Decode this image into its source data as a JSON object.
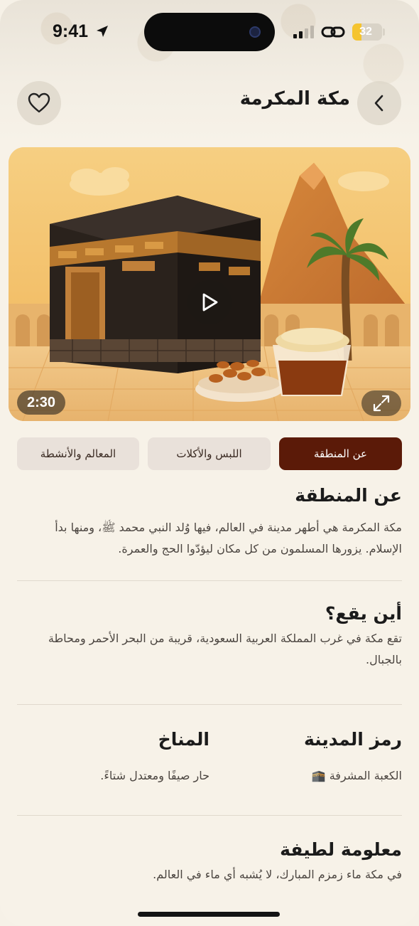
{
  "status_bar": {
    "time": "9:41",
    "battery": "32",
    "battery_level": 0.32
  },
  "header": {
    "title": "مكة المكرمة"
  },
  "media": {
    "duration": "2:30"
  },
  "tabs": [
    {
      "label": "عن المنطقة",
      "active": true
    },
    {
      "label": "اللبس والأكلات",
      "active": false
    },
    {
      "label": "المعالم والأنشطة",
      "active": false
    }
  ],
  "about": {
    "heading": "عن المنطقة",
    "text": "مكة المكرمة هي أطهر مدينة في العالم، فيها وُلد النبي محمد ﷺ، ومنها بدأ الإسلام. يزورها المسلمون من كل مكان ليؤدّوا الحج والعمرة."
  },
  "location": {
    "heading": "أين يقع؟",
    "text": "تقع مكة في غرب المملكة العربية السعودية، قريبة من البحر الأحمر ومحاطة بالجبال."
  },
  "city_symbol": {
    "heading": "رمز المدينة",
    "value": "الكعبة المشرفة 🕋"
  },
  "climate": {
    "heading": "المناخ",
    "value": "حار صيفًا ومعتدل شتاءً."
  },
  "fun_fact": {
    "heading": "معلومة لطيفة",
    "text": "في مكة ماء زمزم المبارك، لا يُشبه أي ماء في العالم."
  },
  "colors": {
    "accent": "#5b1a08",
    "tab_inactive": "#e9e1da",
    "background": "#f7f2e8"
  },
  "icons": [
    "location-arrow-icon",
    "signal-icon",
    "link-icon",
    "battery-icon",
    "heart-icon",
    "chevron-left-icon",
    "play-icon",
    "expand-icon"
  ]
}
